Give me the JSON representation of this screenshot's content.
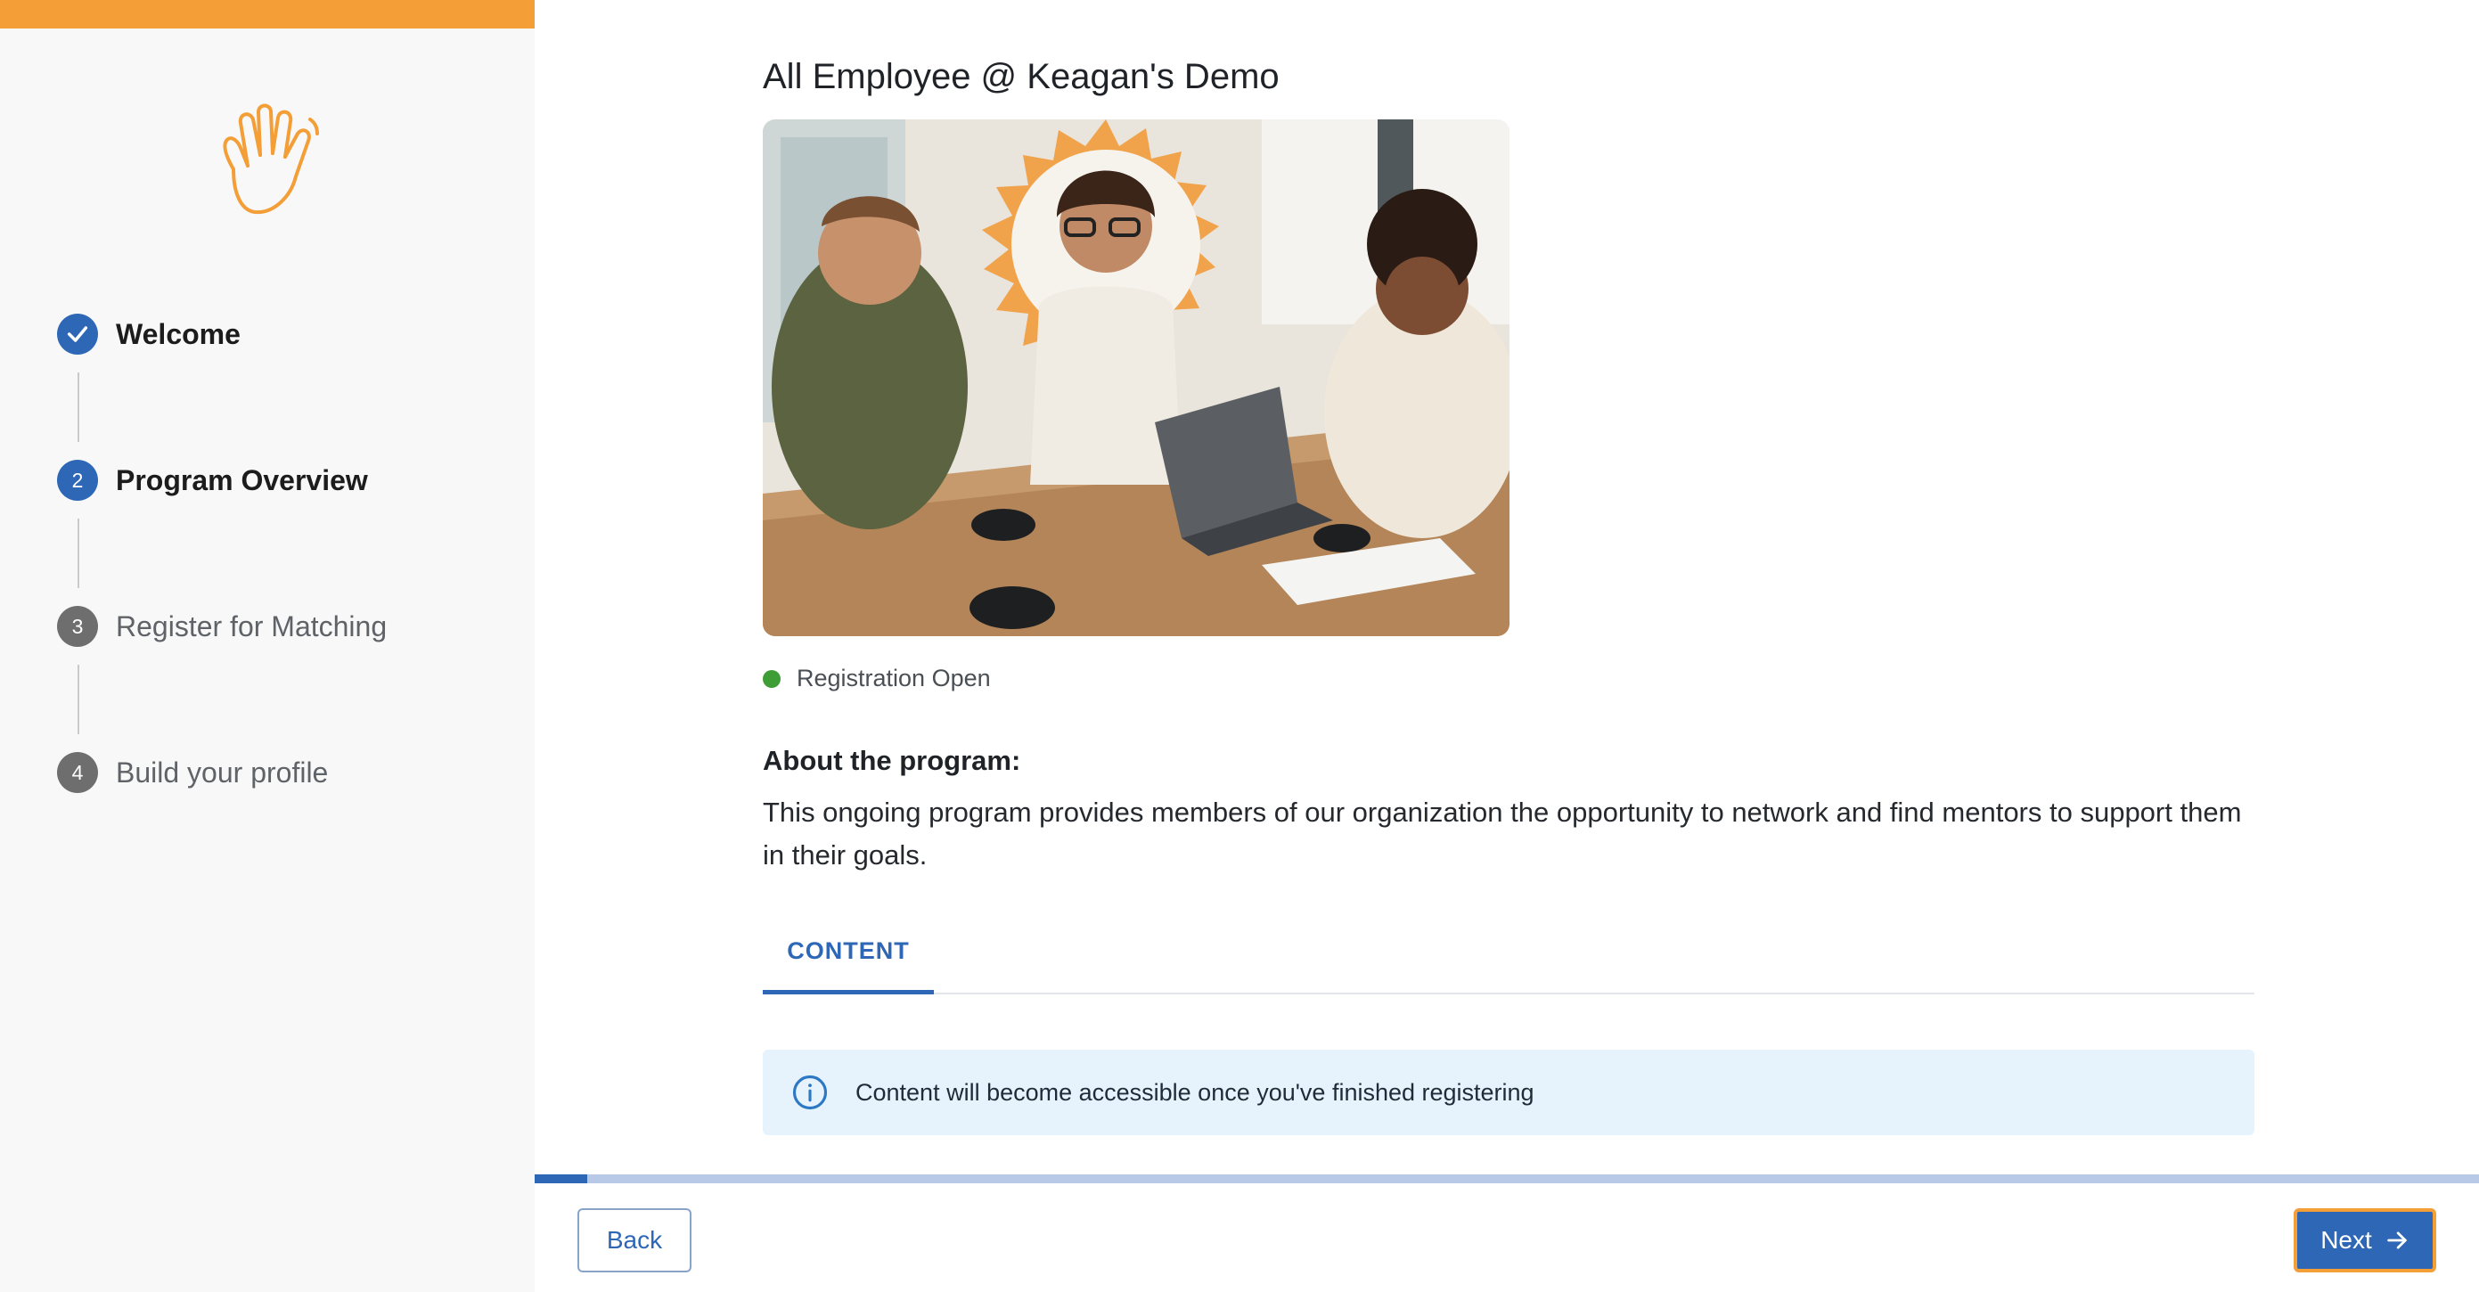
{
  "program": {
    "title": "All Employee @ Keagan's Demo",
    "status": "Registration Open",
    "about_title": "About the program:",
    "about_body": "This ongoing program provides members of our organization the opportunity to network and find mentors to support them in their goals."
  },
  "steps": [
    {
      "number": "",
      "label": "Welcome",
      "state": "completed",
      "icon": "check-icon"
    },
    {
      "number": "2",
      "label": "Program Overview",
      "state": "active"
    },
    {
      "number": "3",
      "label": "Register for Matching",
      "state": "upcoming"
    },
    {
      "number": "4",
      "label": "Build your profile",
      "state": "upcoming"
    }
  ],
  "tabs": [
    {
      "label": "CONTENT",
      "selected": true
    }
  ],
  "info": {
    "text": "Content will become accessible once you've finished registering",
    "icon": "info-icon"
  },
  "progress": {
    "fraction": 0.027
  },
  "footer": {
    "back_label": "Back",
    "next_label": "Next",
    "next_icon": "arrow-right-icon"
  },
  "colors": {
    "accent": "#2d67b6",
    "brand_orange": "#f39e37",
    "status_green": "#3f9d36",
    "info_background": "#e7f3fc"
  }
}
